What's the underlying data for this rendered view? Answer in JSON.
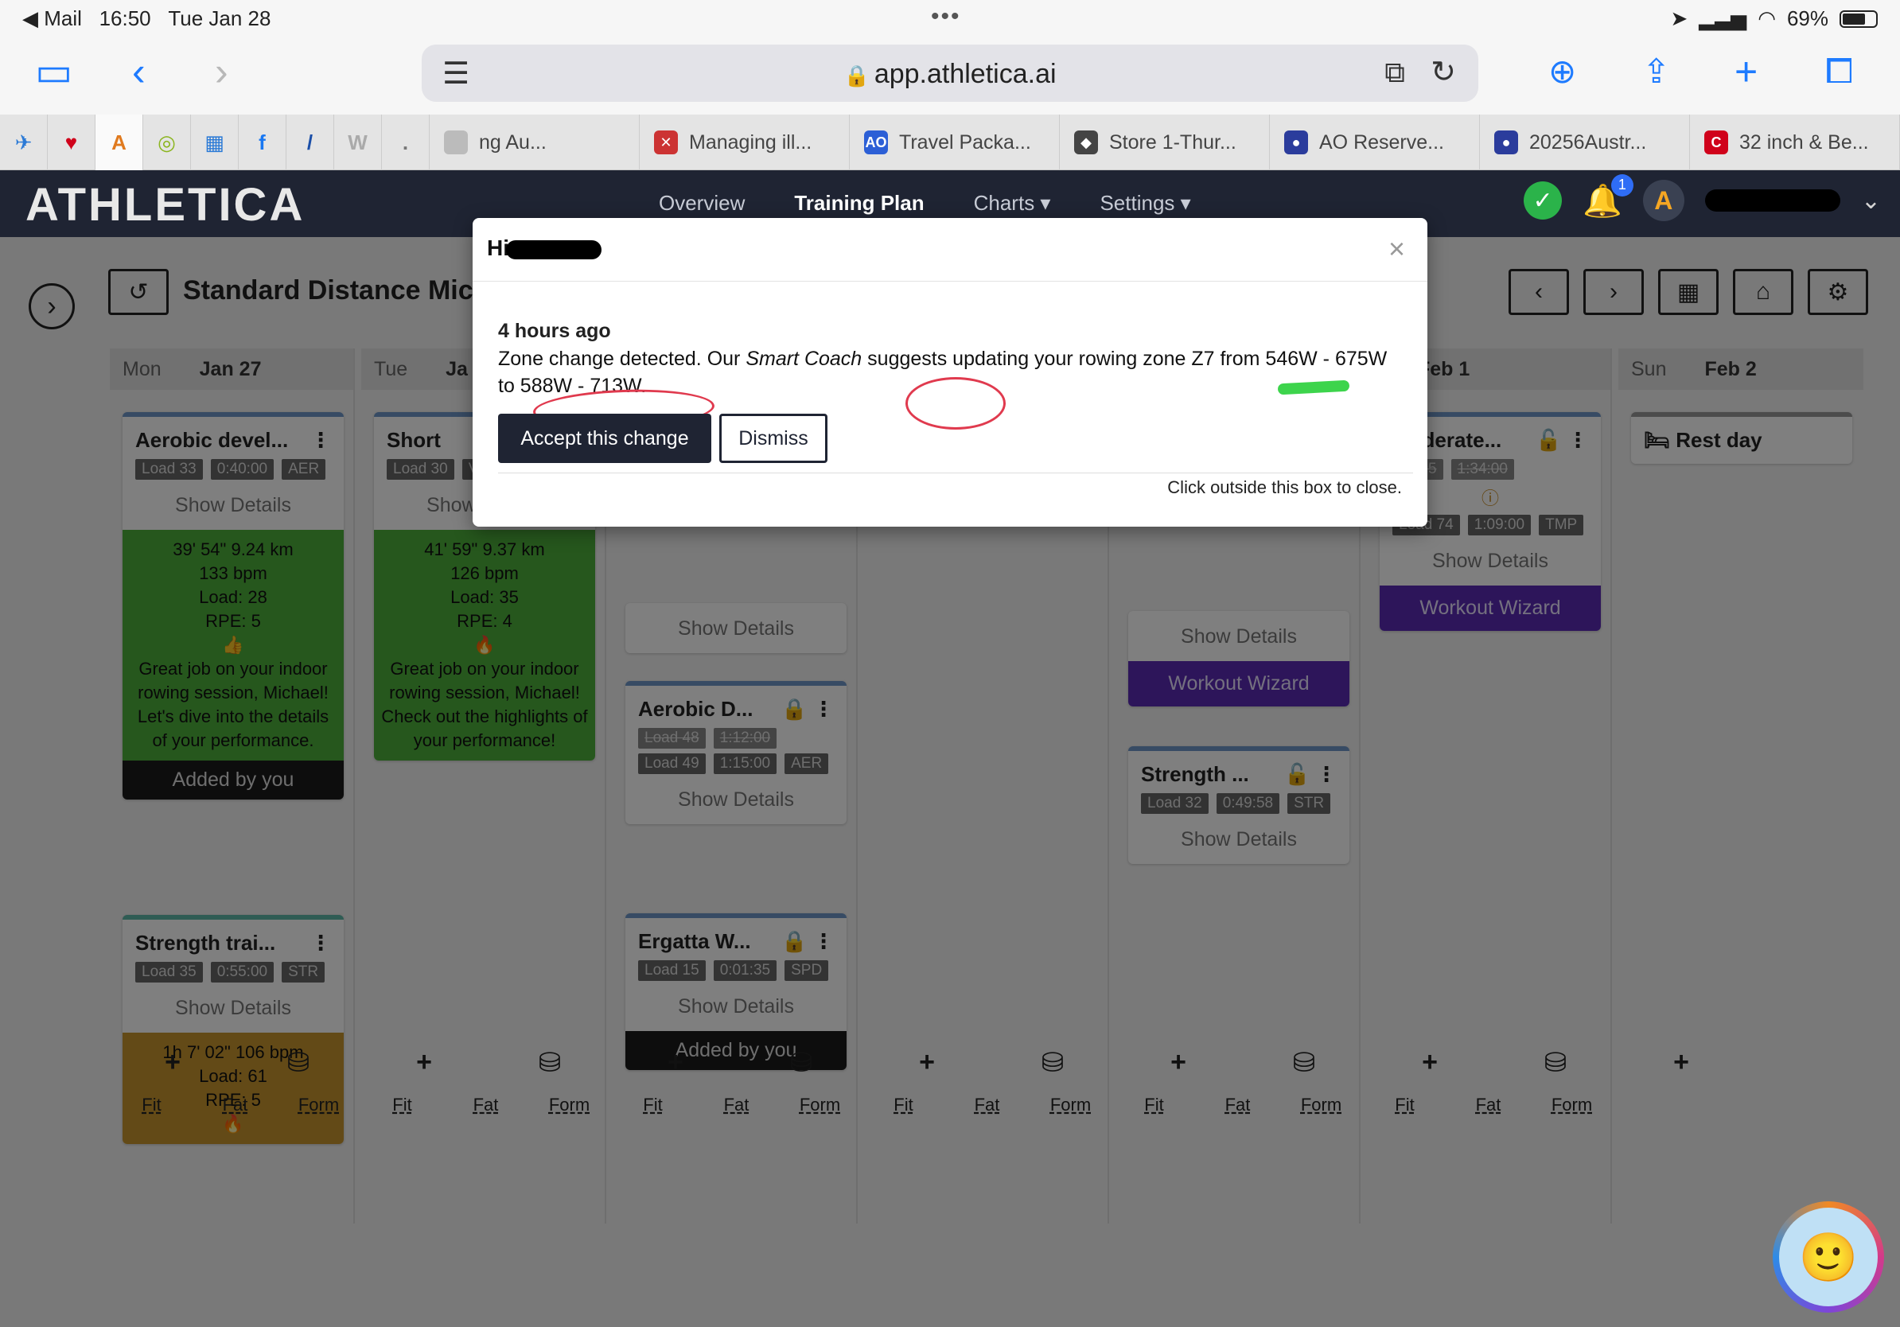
{
  "status": {
    "back_app": "◀ Mail",
    "time": "16:50",
    "date": "Tue Jan 28",
    "battery": "69%"
  },
  "browser": {
    "url": "app.athletica.ai"
  },
  "tabs": [
    {
      "label": "ng Au...",
      "fav": "",
      "color": "#bbb"
    },
    {
      "label": "Managing ill...",
      "fav": "✕",
      "color": "#c33"
    },
    {
      "label": "Travel Packa...",
      "fav": "AO",
      "color": "#2c5fd6"
    },
    {
      "label": "Store 1-Thur...",
      "fav": "◆",
      "color": "#444"
    },
    {
      "label": "AO Reserve...",
      "fav": "●",
      "color": "#2b3c9c"
    },
    {
      "label": "20256Austr...",
      "fav": "●",
      "color": "#2b3c9c"
    },
    {
      "label": "32 inch & Be...",
      "fav": "C",
      "color": "#d0021b"
    }
  ],
  "app": {
    "logo": "ATHLETICA",
    "nav": [
      "Overview",
      "Training Plan",
      "Charts ▾",
      "Settings ▾"
    ],
    "notif_count": "1"
  },
  "plan": {
    "title": "Standard Distance Mic"
  },
  "days": [
    {
      "dn": "Mon",
      "date": "Jan 27"
    },
    {
      "dn": "Tue",
      "date": "Ja"
    },
    {
      "dn": "",
      "date": ""
    },
    {
      "dn": "",
      "date": ""
    },
    {
      "dn": "",
      "date": ""
    },
    {
      "dn": "",
      "date": "Feb 1"
    },
    {
      "dn": "Sun",
      "date": "Feb 2"
    }
  ],
  "cards": {
    "mon1": {
      "title": "Aerobic devel...",
      "load": "Load 33",
      "dur": "0:40:00",
      "zone": "AER",
      "show": "Show Details",
      "res1": "39' 54\"   9.24 km",
      "res2": "133 bpm",
      "res3": "Load: 28",
      "res4": "RPE: 5",
      "res5": "Great job on your indoor rowing session, Michael! Let's dive into the details of your performance.",
      "added": "Added by you"
    },
    "mon2": {
      "title": "Strength trai...",
      "load": "Load 35",
      "dur": "0:55:00",
      "zone": "STR",
      "show": "Show Details",
      "res1": "1h 7' 02\"   106 bpm",
      "res2": "Load: 61",
      "res3": "RPE: 5"
    },
    "tue1": {
      "title": "Short",
      "load": "Load 30",
      "zone": "VO2",
      "show": "Show Details",
      "res1": "41' 59\"   9.37 km",
      "res2": "126 bpm",
      "res3": "Load: 35",
      "res4": "RPE: 4",
      "res5": "Great job on your indoor rowing session, Michael! Check out the highlights of your performance!"
    },
    "wed0": {
      "show": "Show Details"
    },
    "wed1": {
      "title": "Aerobic D...",
      "old_load": "Load 48",
      "old_dur": "1:12:00",
      "load": "Load 49",
      "dur": "1:15:00",
      "zone": "AER",
      "show": "Show Details"
    },
    "wed2": {
      "title": "Ergatta W...",
      "load": "Load 15",
      "dur": "0:01:35",
      "zone": "SPD",
      "show": "Show Details",
      "added": "Added by you"
    },
    "fri0": {
      "show": "Show Details",
      "wizard": "Workout Wizard"
    },
    "fri1": {
      "title": "Strength ...",
      "load": "Load 32",
      "dur": "0:49:58",
      "zone": "STR",
      "show": "Show Details"
    },
    "sat1": {
      "title": "Moderate...",
      "old_load": "d 105",
      "old_dur": "1:34:00",
      "load": "Load 74",
      "dur": "1:09:00",
      "zone": "TMP",
      "show": "Show Details",
      "wizard": "Workout Wizard"
    },
    "sun1": {
      "title": "Rest day"
    }
  },
  "footer": {
    "fit": "Fit",
    "fat": "Fat",
    "form": "Form"
  },
  "modal": {
    "title": "Hi",
    "time": "4 hours ago",
    "msg_pre": "Zone change detected. Our ",
    "msg_em": "Smart Coach",
    "msg_post": " suggests updating your rowing zone Z7 from 546W - 675W to 588W - 713W.",
    "accept": "Accept this change",
    "dismiss": "Dismiss",
    "footnote": "Click outside this box to close."
  }
}
